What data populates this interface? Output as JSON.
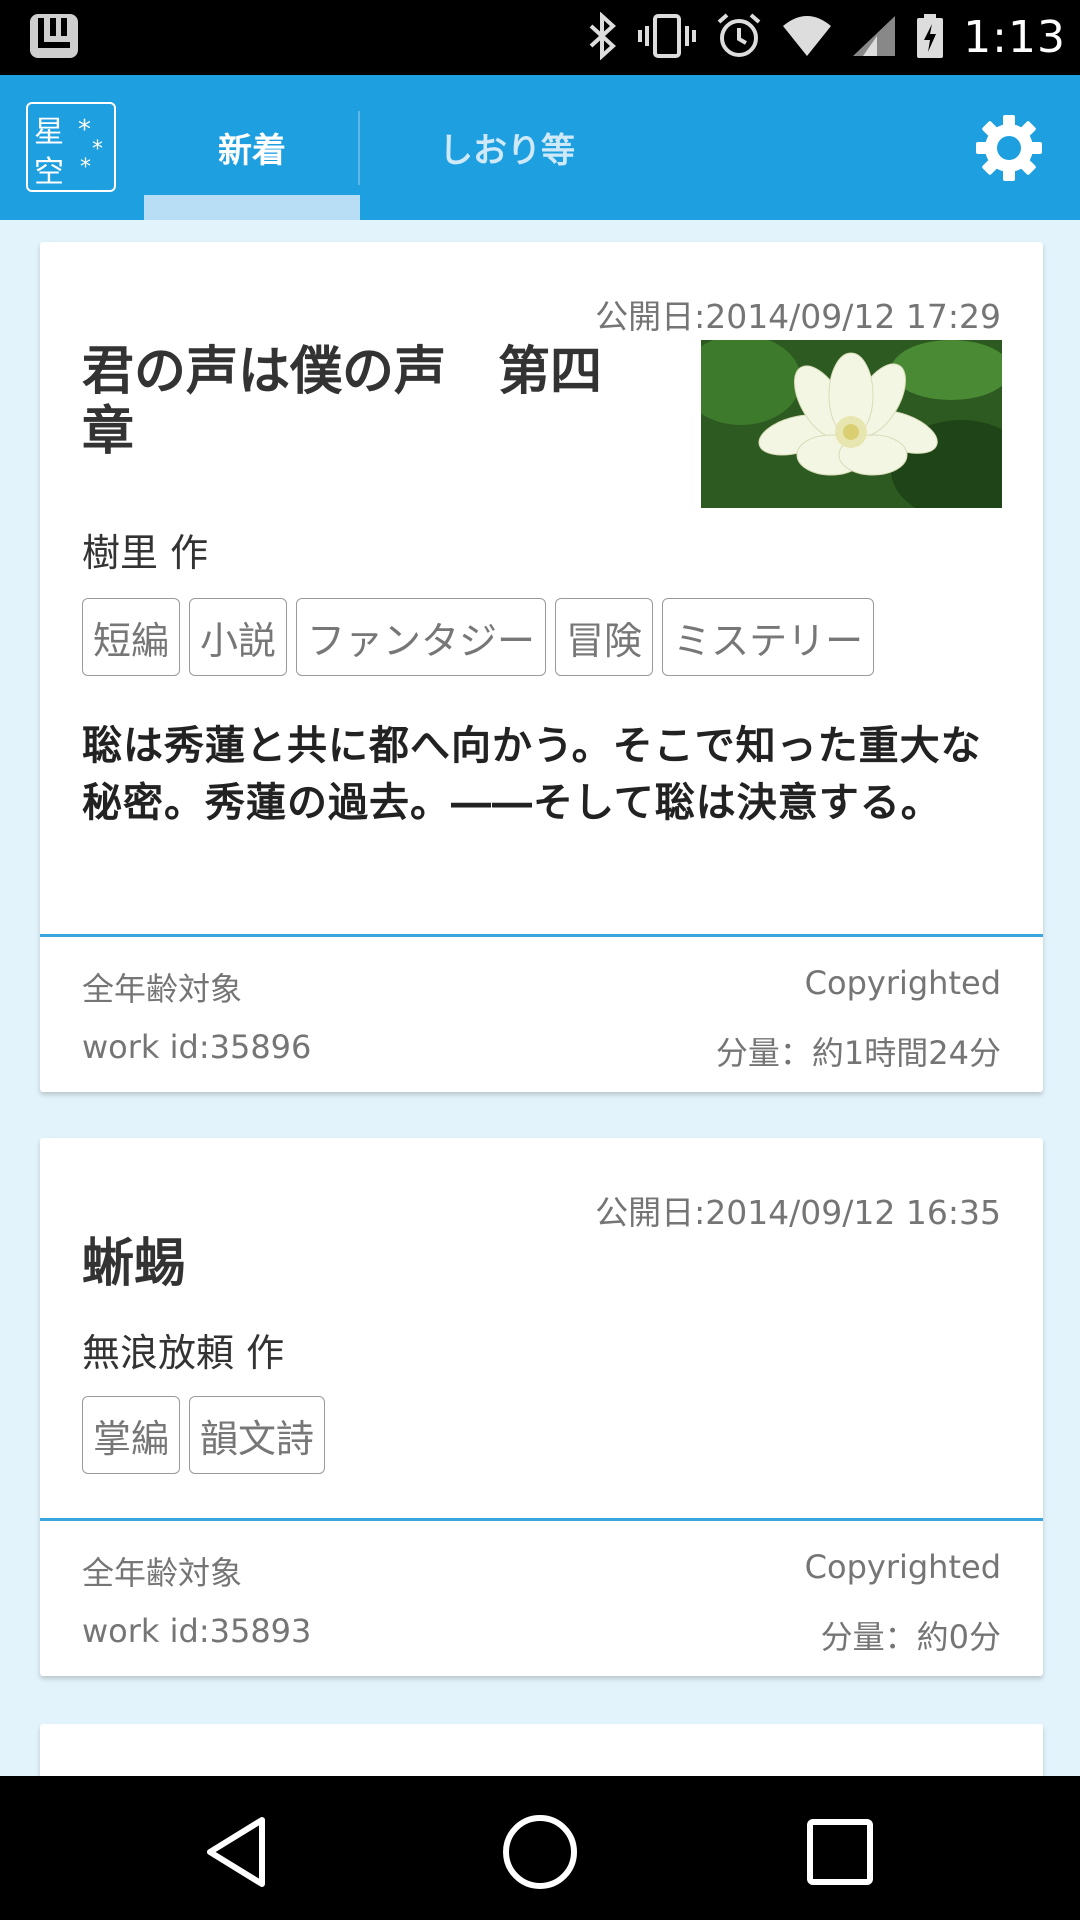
{
  "status_bar": {
    "time": "1:13",
    "icons": [
      "notification-icon",
      "bluetooth-icon",
      "vibrate-icon",
      "alarm-icon",
      "wifi-icon",
      "cell-signal-icon",
      "battery-icon"
    ]
  },
  "app_bar": {
    "logo": {
      "text": "星空"
    },
    "tabs": [
      {
        "label": "新着",
        "active": true
      },
      {
        "label": "しおり等",
        "active": false
      }
    ],
    "settings_icon": "gear-icon"
  },
  "works": [
    {
      "published": "公開日:2014/09/12 17:29",
      "title": "君の声は僕の声　第四章",
      "author": "樹里  作",
      "tags": [
        "短編",
        "小説",
        "ファンタジー",
        "冒険",
        "ミステリー"
      ],
      "description": "聡は秀蓮と共に都へ向かう。そこで知った重大な秘密。秀蓮の過去。――そして聡は決意する。",
      "rating": "全年齢対象",
      "copyright": "Copyrighted",
      "work_id": "work id:35896",
      "length": "分量：約1時間24分",
      "thumbnail": "white-lotus-flower-image"
    },
    {
      "published": "公開日:2014/09/12 16:35",
      "title": "蜥蜴",
      "author": "無浪放頼  作",
      "tags": [
        "掌編",
        "韻文詩"
      ],
      "rating": "全年齢対象",
      "copyright": "Copyrighted",
      "work_id": "work id:35893",
      "length": "分量：約0分"
    }
  ],
  "colors": {
    "app_bar": "#1e9fe0",
    "background": "#e3f3fb",
    "divider": "#3aa6dd"
  }
}
